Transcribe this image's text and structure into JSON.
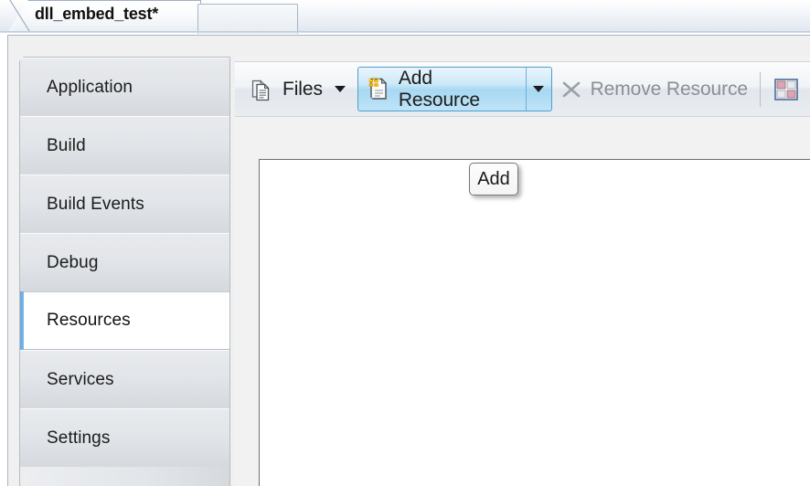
{
  "window": {
    "tabs": [
      {
        "label": "dll_embed_test*",
        "active": true
      },
      {
        "label": "",
        "active": false
      }
    ]
  },
  "sidebar": {
    "items": [
      {
        "label": "Application",
        "selected": false
      },
      {
        "label": "Build",
        "selected": false
      },
      {
        "label": "Build Events",
        "selected": false
      },
      {
        "label": "Debug",
        "selected": false
      },
      {
        "label": "Resources",
        "selected": true
      },
      {
        "label": "Services",
        "selected": false
      },
      {
        "label": "Settings",
        "selected": false
      }
    ],
    "accent_color": "#6aabe2"
  },
  "toolbar": {
    "files": {
      "label": "Files",
      "icon": "documents-stack-icon",
      "dropdown_icon": "chevron-down-icon"
    },
    "add_resource": {
      "label": "Add Resource",
      "icon": "new-document-sparkle-icon",
      "dropdown_icon": "chevron-down-icon",
      "state": "hovered",
      "highlight_color": "#a8d8f2",
      "border_color": "#4d9ecf"
    },
    "remove_resource": {
      "label": "Remove Resource",
      "icon": "x-cross-icon",
      "state": "disabled",
      "disabled_color": "#8b8f93"
    },
    "views_button": {
      "icon": "views-grid-icon",
      "label": ""
    }
  },
  "tooltip": {
    "text": "Add"
  }
}
